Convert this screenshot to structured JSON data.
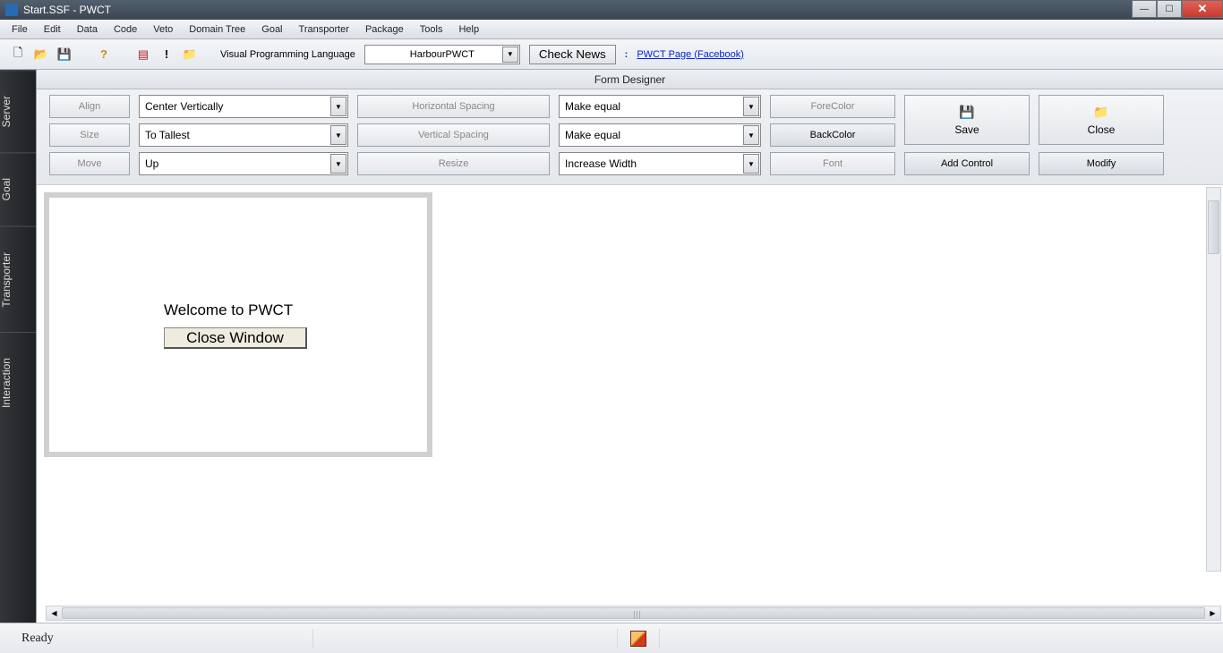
{
  "title": "Start.SSF  - PWCT",
  "menu": [
    "File",
    "Edit",
    "Data",
    "Code",
    "Veto",
    "Domain Tree",
    "Goal",
    "Transporter",
    "Package",
    "Tools",
    "Help"
  ],
  "toolbar": {
    "label": "Visual Programming Language",
    "select": "HarbourPWCT",
    "check_news": "Check News",
    "link": "PWCT Page (Facebook)"
  },
  "sidebar": [
    "Server",
    "Goal",
    "Transporter",
    "Interaction"
  ],
  "form_designer": {
    "title": "Form Designer",
    "row1": {
      "align": "Align",
      "align_sel": "Center Vertically",
      "hs": "Horizontal Spacing",
      "hs_sel": "Make equal",
      "fore": "ForeColor"
    },
    "row2": {
      "size": "Size",
      "size_sel": "To Tallest",
      "vs": "Vertical Spacing",
      "vs_sel": "Make equal",
      "back": "BackColor"
    },
    "row3": {
      "move": "Move",
      "move_sel": "Up",
      "resize": "Resize",
      "resize_sel": "Increase Width",
      "font": "Font",
      "add": "Add Control",
      "modify": "Modify"
    },
    "save": "Save",
    "close": "Close"
  },
  "form": {
    "welcome": "Welcome to PWCT",
    "close_btn": "Close Window"
  },
  "status": {
    "ready": "Ready"
  }
}
